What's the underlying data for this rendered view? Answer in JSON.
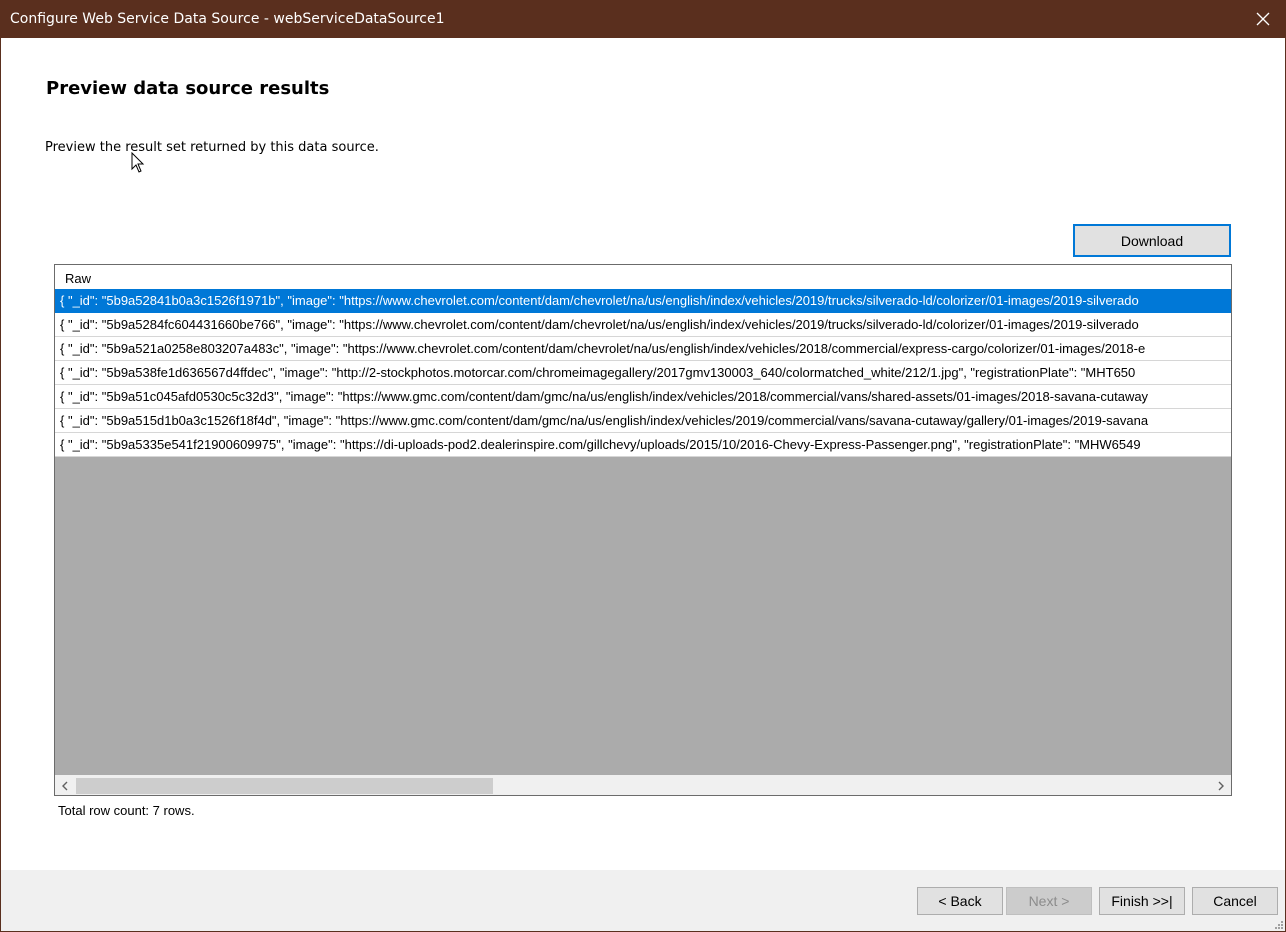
{
  "window": {
    "title": "Configure Web Service Data Source - webServiceDataSource1",
    "close_icon": "close-icon"
  },
  "page": {
    "heading": "Preview data source results",
    "description": "Preview the result set returned by this data source."
  },
  "toolbar": {
    "download_label": "Download"
  },
  "grid": {
    "column_header": "Raw",
    "selected_row": 0,
    "rows": [
      "{  \"_id\": \"5b9a52841b0a3c1526f1971b\",  \"image\": \"https://www.chevrolet.com/content/dam/chevrolet/na/us/english/index/vehicles/2019/trucks/silverado-ld/colorizer/01-images/2019-silverado",
      "{  \"_id\": \"5b9a5284fc604431660be766\",  \"image\": \"https://www.chevrolet.com/content/dam/chevrolet/na/us/english/index/vehicles/2019/trucks/silverado-ld/colorizer/01-images/2019-silverado",
      "{  \"_id\": \"5b9a521a0258e803207a483c\",  \"image\": \"https://www.chevrolet.com/content/dam/chevrolet/na/us/english/index/vehicles/2018/commercial/express-cargo/colorizer/01-images/2018-e",
      "{  \"_id\": \"5b9a538fe1d636567d4ffdec\",  \"image\": \"http://2-stockphotos.motorcar.com/chromeimagegallery/2017gmv130003_640/colormatched_white/212/1.jpg\",  \"registrationPlate\": \"MHT650",
      "{  \"_id\": \"5b9a51c045afd0530c5c32d3\",  \"image\": \"https://www.gmc.com/content/dam/gmc/na/us/english/index/vehicles/2018/commercial/vans/shared-assets/01-images/2018-savana-cutaway",
      "{  \"_id\": \"5b9a515d1b0a3c1526f18f4d\",  \"image\": \"https://www.gmc.com/content/dam/gmc/na/us/english/index/vehicles/2019/commercial/vans/savana-cutaway/gallery/01-images/2019-savana",
      "{  \"_id\": \"5b9a5335e541f21900609975\",  \"image\": \"https://di-uploads-pod2.dealerinspire.com/gillchevy/uploads/2015/10/2016-Chevy-Express-Passenger.png\",  \"registrationPlate\": \"MHW6549"
    ],
    "row_count_text": "Total row count: 7 rows."
  },
  "footer": {
    "back_label": "< Back",
    "next_label": "Next >",
    "finish_label": "Finish >>|",
    "cancel_label": "Cancel",
    "next_disabled": true
  },
  "colors": {
    "titlebar": "#5a2f1e",
    "selection": "#0078d7",
    "grid_empty": "#ababab",
    "footer": "#f0f0f0"
  }
}
